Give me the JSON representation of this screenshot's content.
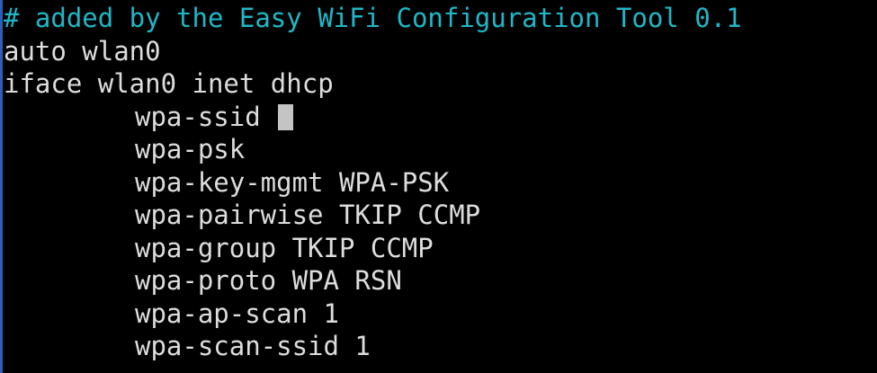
{
  "editor": {
    "header_comment": "# added by the Easy WiFi Configuration Tool 0.1",
    "lines": [
      "auto wlan0",
      "iface wlan0 inet dhcp"
    ],
    "options": [
      "wpa-ssid ",
      "wpa-psk",
      "wpa-key-mgmt WPA-PSK",
      "wpa-pairwise TKIP CCMP",
      "wpa-group TKIP CCMP",
      "wpa-proto WPA RSN",
      "wpa-ap-scan 1",
      "wpa-scan-ssid 1"
    ]
  },
  "colors": {
    "background": "#000000",
    "text": "#dddddd",
    "comment": "#1fb7c7",
    "cursor": "#c4c4c4",
    "left_border": "#2b5fb8"
  }
}
